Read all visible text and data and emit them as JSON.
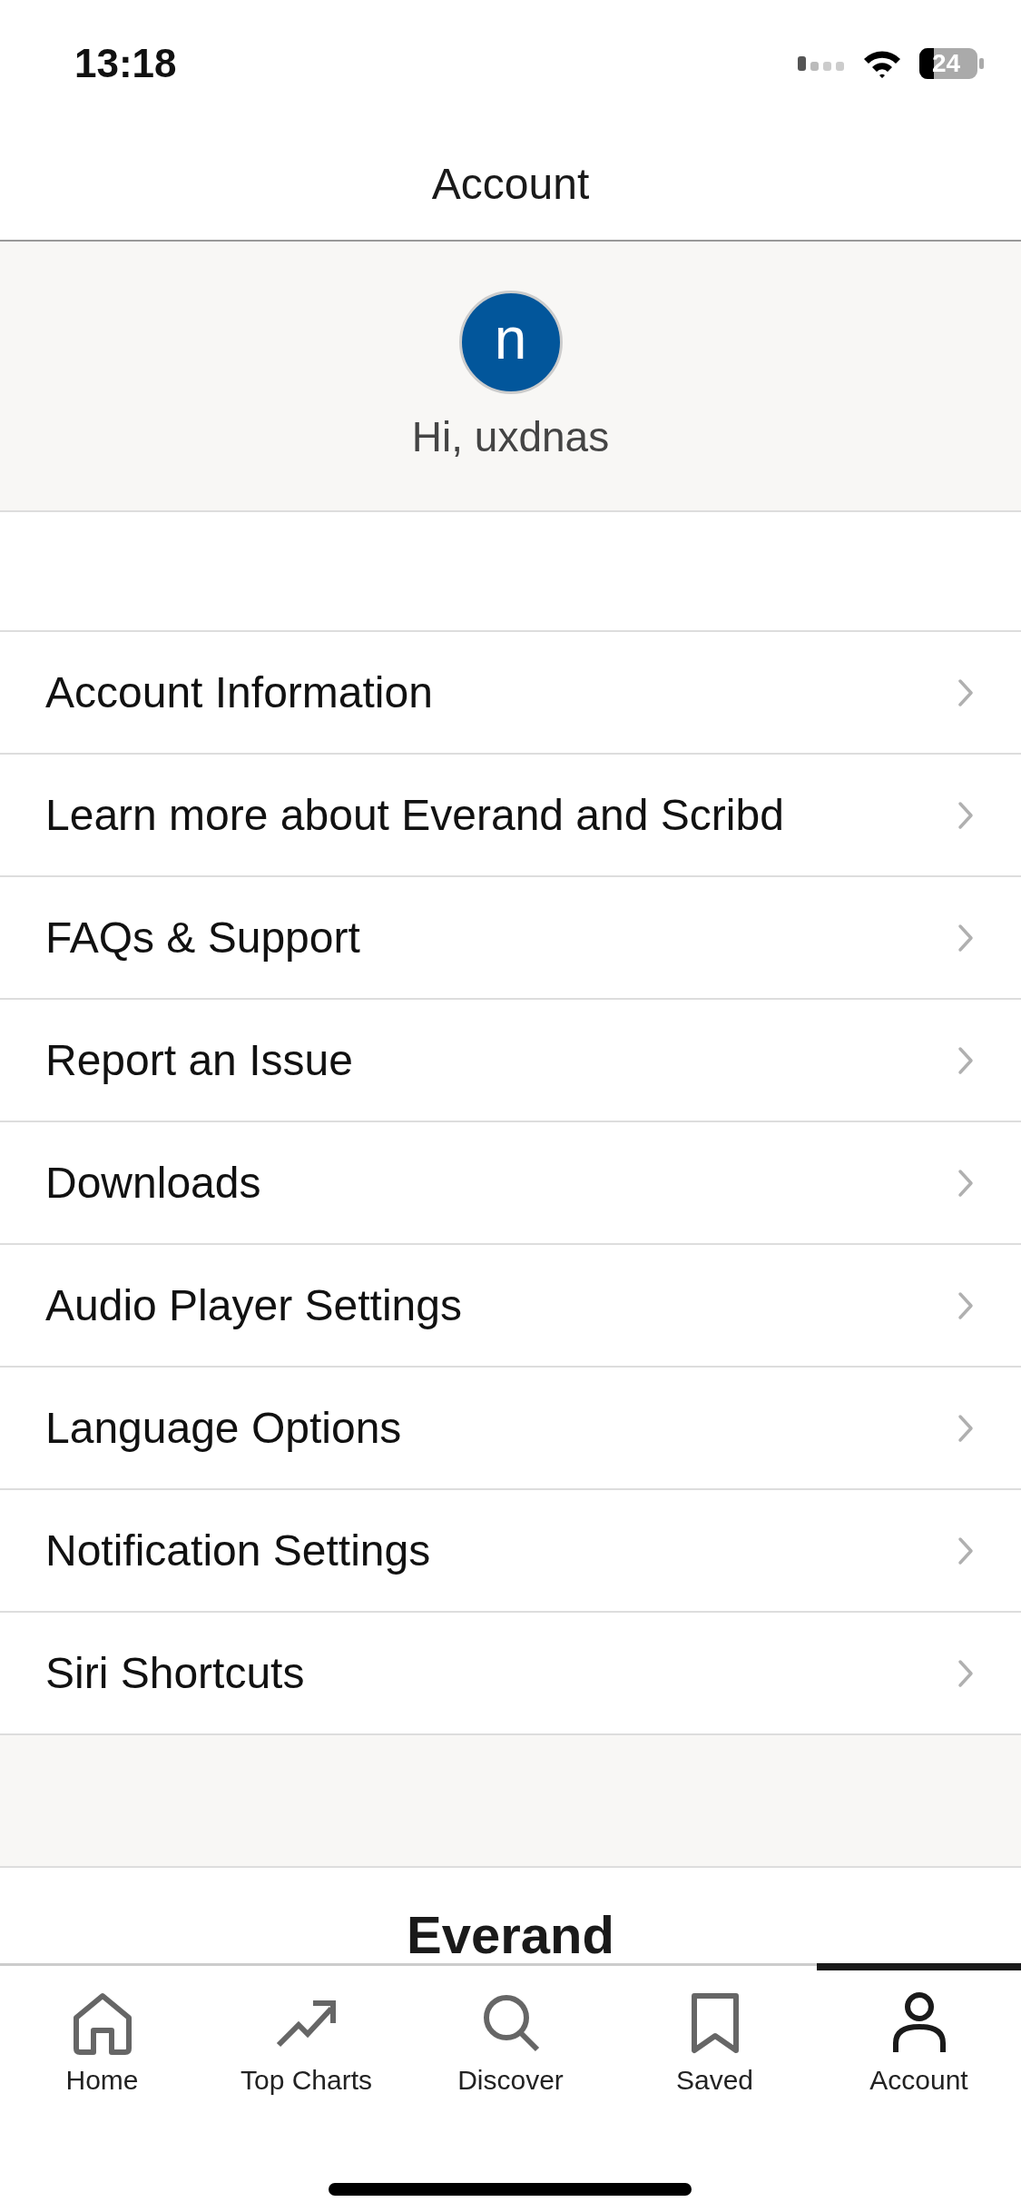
{
  "status_bar": {
    "time": "13:18",
    "battery": "24"
  },
  "header": {
    "title": "Account"
  },
  "profile": {
    "initial": "n",
    "greeting": "Hi, uxdnas"
  },
  "menu": [
    {
      "label": "Account Information"
    },
    {
      "label": "Learn more about Everand and Scribd"
    },
    {
      "label": "FAQs & Support"
    },
    {
      "label": "Report an Issue"
    },
    {
      "label": "Downloads"
    },
    {
      "label": "Audio Player Settings"
    },
    {
      "label": "Language Options"
    },
    {
      "label": "Notification Settings"
    },
    {
      "label": "Siri Shortcuts"
    }
  ],
  "footer_logo": "Everand",
  "tabs": [
    {
      "label": "Home",
      "selected": false
    },
    {
      "label": "Top Charts",
      "selected": false
    },
    {
      "label": "Discover",
      "selected": false
    },
    {
      "label": "Saved",
      "selected": false
    },
    {
      "label": "Account",
      "selected": true
    }
  ]
}
